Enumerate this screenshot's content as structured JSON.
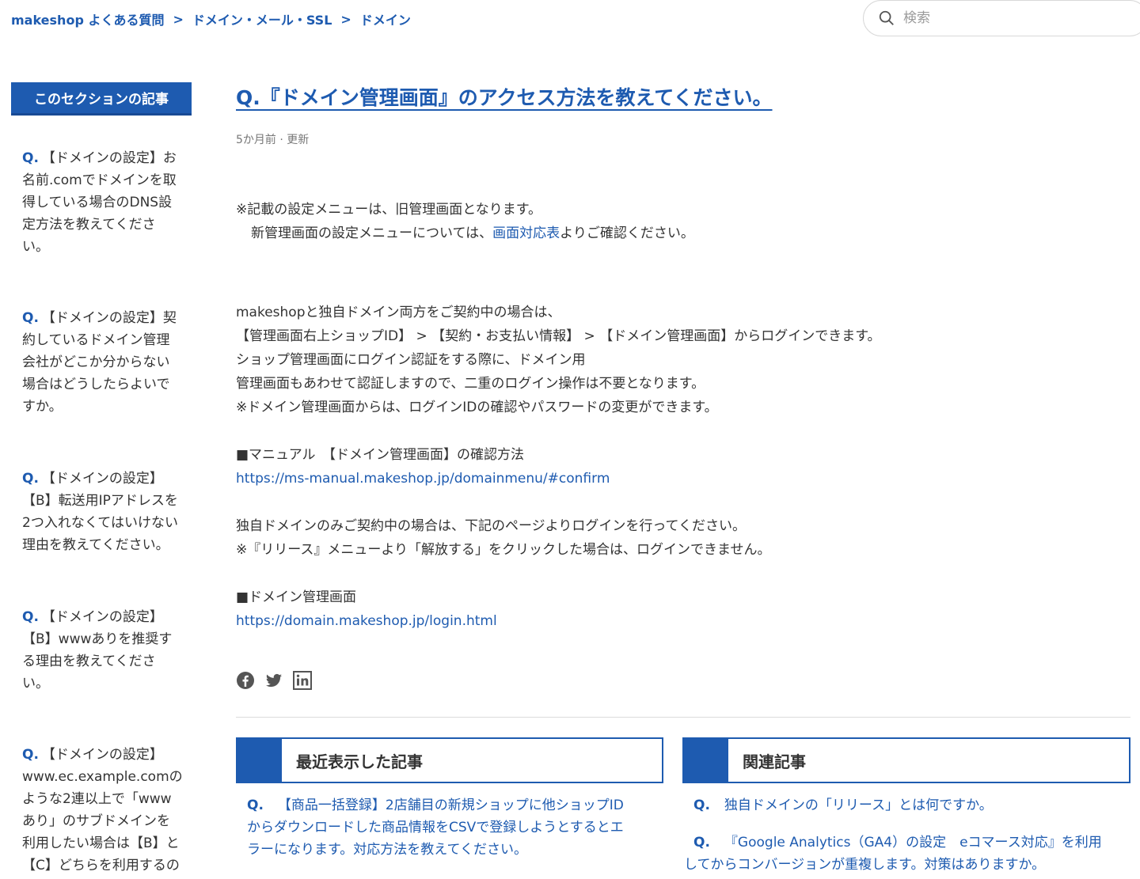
{
  "breadcrumb": {
    "items": [
      "makeshop よくある質問",
      "ドメイン・メール・SSL",
      "ドメイン"
    ],
    "separator": ">"
  },
  "search": {
    "placeholder": "検索"
  },
  "sidebar": {
    "header": "このセクションの記事",
    "q_prefix": "Q.",
    "items": [
      [
        "【ドメインの設定】お",
        "名前.comでドメインを取",
        "得している場合のDNS設",
        "定方法を教えてくださ",
        "い。"
      ],
      [
        "【ドメインの設定】契",
        "約しているドメイン管理",
        "会社がどこか分からない",
        "場合はどうしたらよいで",
        "すか。"
      ],
      [
        "【ドメインの設定】",
        "【B】転送用IPアドレスを",
        "2つ入れなくてはいけない",
        "理由を教えてください。"
      ],
      [
        "【ドメインの設定】",
        "【B】wwwありを推奨す",
        "る理由を教えてくださ",
        "い。"
      ],
      [
        "【ドメインの設定】",
        "www.ec.example.comの",
        "ような2連以上で「www",
        "あり」のサブドメインを",
        "利用したい場合は【B】と",
        "【C】どちらを利用するの"
      ]
    ]
  },
  "article": {
    "title": "Q.『ドメイン管理画面』のアクセス方法を教えてください。",
    "meta": "5か月前 · 更新",
    "notice_line1": "※記載の設定メニューは、旧管理画面となります。",
    "notice_line2_pre": "新管理画面の設定メニューについては、",
    "notice_link": "画面対応表",
    "notice_line2_post": "よりご確認ください。",
    "body_lines": [
      "makeshopと独自ドメイン両方をご契約中の場合は、",
      "【管理画面右上ショップID】 > 【契約・お支払い情報】 > 【ドメイン管理画面】からログインできます。",
      "ショップ管理画面にログイン認証をする際に、ドメイン用",
      "管理画面もあわせて認証しますので、二重のログイン操作は不要となります。",
      "※ドメイン管理画面からは、ログインIDの確認やパスワードの変更ができます。"
    ],
    "manual_heading": "■マニュアル　【ドメイン管理画面】の確認方法",
    "manual_link": "https://ms-manual.makeshop.jp/domainmenu/#confirm",
    "own_domain_lines": [
      "独自ドメインのみご契約中の場合は、下記のページよりログインを行ってください。",
      "※『リリース』メニューより「解放する」をクリックした場合は、ログインできません。"
    ],
    "domain_heading": "■ドメイン管理画面",
    "domain_link": "https://domain.makeshop.jp/login.html"
  },
  "share_icons": [
    "facebook-icon",
    "twitter-icon",
    "linkedin-icon"
  ],
  "recent": {
    "title": "最近表示した記事",
    "items": [
      [
        "【商品一括登録】2店舗目の新規ショップに他ショップID",
        "からダウンロードした商品情報をCSVで登録しようとするとエ",
        "ラーになります。対応方法を教えてください。"
      ]
    ]
  },
  "related": {
    "title": "関連記事",
    "items": [
      [
        "独自ドメインの「リリース」とは何ですか。"
      ],
      [
        "『Google Analytics（GA4）の設定　eコマース対応』を利用",
        "してからコンバージョンが重複します。対策はありますか。"
      ]
    ]
  },
  "colors": {
    "brand_blue": "#1e5bb0",
    "text": "#333333",
    "muted": "#777777"
  }
}
